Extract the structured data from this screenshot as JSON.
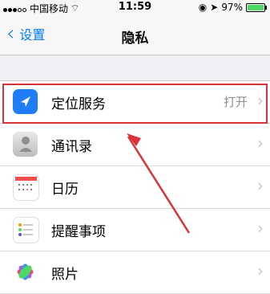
{
  "status": {
    "carrier": "中国移动",
    "time": "11:59",
    "battery": "97%",
    "battery_color": "#4cd964"
  },
  "nav": {
    "back": "设置",
    "title": "隐私"
  },
  "rows": [
    {
      "label": "定位服务",
      "value": "打开",
      "icon": "location-arrow-icon"
    },
    {
      "label": "通讯录",
      "icon": "contacts-icon"
    },
    {
      "label": "日历",
      "icon": "calendar-icon"
    },
    {
      "label": "提醒事项",
      "icon": "reminders-icon"
    },
    {
      "label": "照片",
      "icon": "photos-icon"
    }
  ],
  "accent": "#007aff",
  "highlight_color": "#d83338"
}
